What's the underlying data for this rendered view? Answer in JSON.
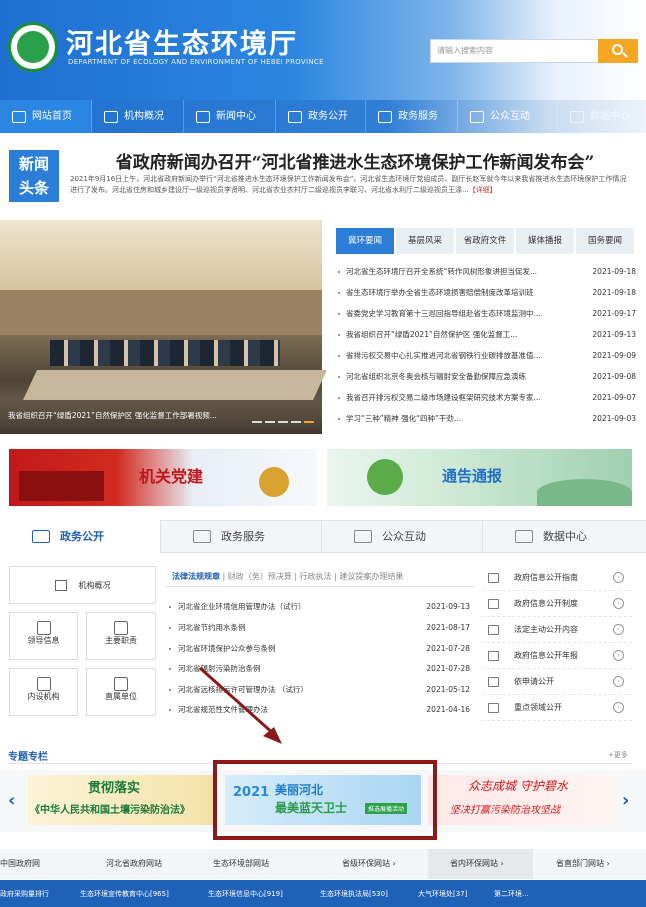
{
  "header": {
    "title": "河北省生态环境厅",
    "subtitle_en": "DEPARTMENT OF ECOLOGY AND ENVIRONMENT OF HEBEI PROVINCE",
    "logo_text": "HB",
    "search_placeholder": "请输入搜索内容"
  },
  "nav": [
    "网站首页",
    "机构概况",
    "新闻中心",
    "政务公开",
    "政务服务",
    "公众互动",
    "数据中心"
  ],
  "headline": {
    "badge_1": "新闻",
    "badge_2": "头条",
    "title": "省政府新闻办召开“河北省推进水生态环境保护工作新闻发布会”",
    "summary": "2021年9月16日上午，河北省政府新闻办举行“河北省推进水生态环境保护工作新闻发布会”。河北省生态环境厅党组成员、副厅长赵军就今年以来我省推进水生态环境保护工作情况进行了发布。河北省住房和城乡建设厅一级巡视员李贤明、河北省农业农村厅二级巡视员李联习、河北省水利厅二级巡视员王涤...",
    "more": "【详细】"
  },
  "photo": {
    "caption": "我省组织召开“绿盾2021”自然保护区 强化监督工作部署视频..."
  },
  "news_tabs": [
    "冀环要闻",
    "基层风采",
    "省政府文件",
    "媒体播报",
    "国务要闻"
  ],
  "news": [
    {
      "t": "河北省生态环境厅召开全系统“转作风树形象讲担当促发...",
      "d": "2021-09-18"
    },
    {
      "t": "省生态环境厅举办全省生态环境损害赔偿制度改革培训班",
      "d": "2021-09-18"
    },
    {
      "t": "省委党史学习教育第十三巡回指导组赴省生态环境监测中...",
      "d": "2021-09-17"
    },
    {
      "t": "我省组织召开“绿盾2021”自然保护区 强化监督工...",
      "d": "2021-09-13"
    },
    {
      "t": "省排污权交易中心扎实推进河北省钢铁行业碳排放基准值...",
      "d": "2021-09-09"
    },
    {
      "t": "河北省组织北京冬奥会核与辐射安全备勤保障应急演练",
      "d": "2021-09-08"
    },
    {
      "t": "我省召开排污权交易二级市场建设框架研究技术方案专家...",
      "d": "2021-09-07"
    },
    {
      "t": "学习“三种”精神 强化“四种”干劲...",
      "d": "2021-09-03"
    }
  ],
  "banners": {
    "left": "机关党建",
    "right": "通告通报"
  },
  "sections": [
    "政务公开",
    "政务服务",
    "公众互动",
    "数据中心"
  ],
  "grid": {
    "top": "机构概况",
    "items": [
      "领导信息",
      "主要职责",
      "内设机构",
      "直属单位"
    ]
  },
  "mid_tabs": {
    "active": "法律法规规章",
    "rest": "财政（务）预决算 | 行政执法 | 建议提案办理结果"
  },
  "laws": [
    {
      "t": "河北省企业环境信用管理办法（试行）",
      "d": "2021-09-13"
    },
    {
      "t": "河北省节约用水条例",
      "d": "2021-08-17"
    },
    {
      "t": "河北省环境保护公众参与条例",
      "d": "2021-07-28"
    },
    {
      "t": "河北省辐射污染防治条例",
      "d": "2021-07-28"
    },
    {
      "t": "河北省远核排污许可管理办法   （试行）",
      "d": "2021-05-12"
    },
    {
      "t": "河北省规范性文件管理办法",
      "d": "2021-04-16"
    }
  ],
  "right_list": [
    "政府信息公开指南",
    "政府信息公开制度",
    "法定主动公开内容",
    "政府信息公开年报",
    "依申请公开",
    "重点领域公开"
  ],
  "special": {
    "title": "专题专栏",
    "more": "+更多",
    "b1a": "贯彻落实",
    "b1b": "《中华人民共和国土壤污染防治法》",
    "b2yr": "2021",
    "b2a": "美丽河北",
    "b2b": "最美蓝天卫士",
    "b2c": "推选展播活动",
    "b3a": "众志成城 守护碧水",
    "b3b": "坚决打赢污染防治攻坚战"
  },
  "links": [
    "中国政府网",
    "河北省政府网站",
    "生态环境部网站",
    "省级环保网站 ›",
    "省内环保网站 ›",
    "省直部门网站 ›"
  ],
  "footer": [
    "政府采购量排行",
    "生态环境宣传教育中心[965]",
    "生态环境信息中心[919]",
    "生态环境执法局[530]",
    "大气环境处[37]",
    "第二环境..."
  ]
}
